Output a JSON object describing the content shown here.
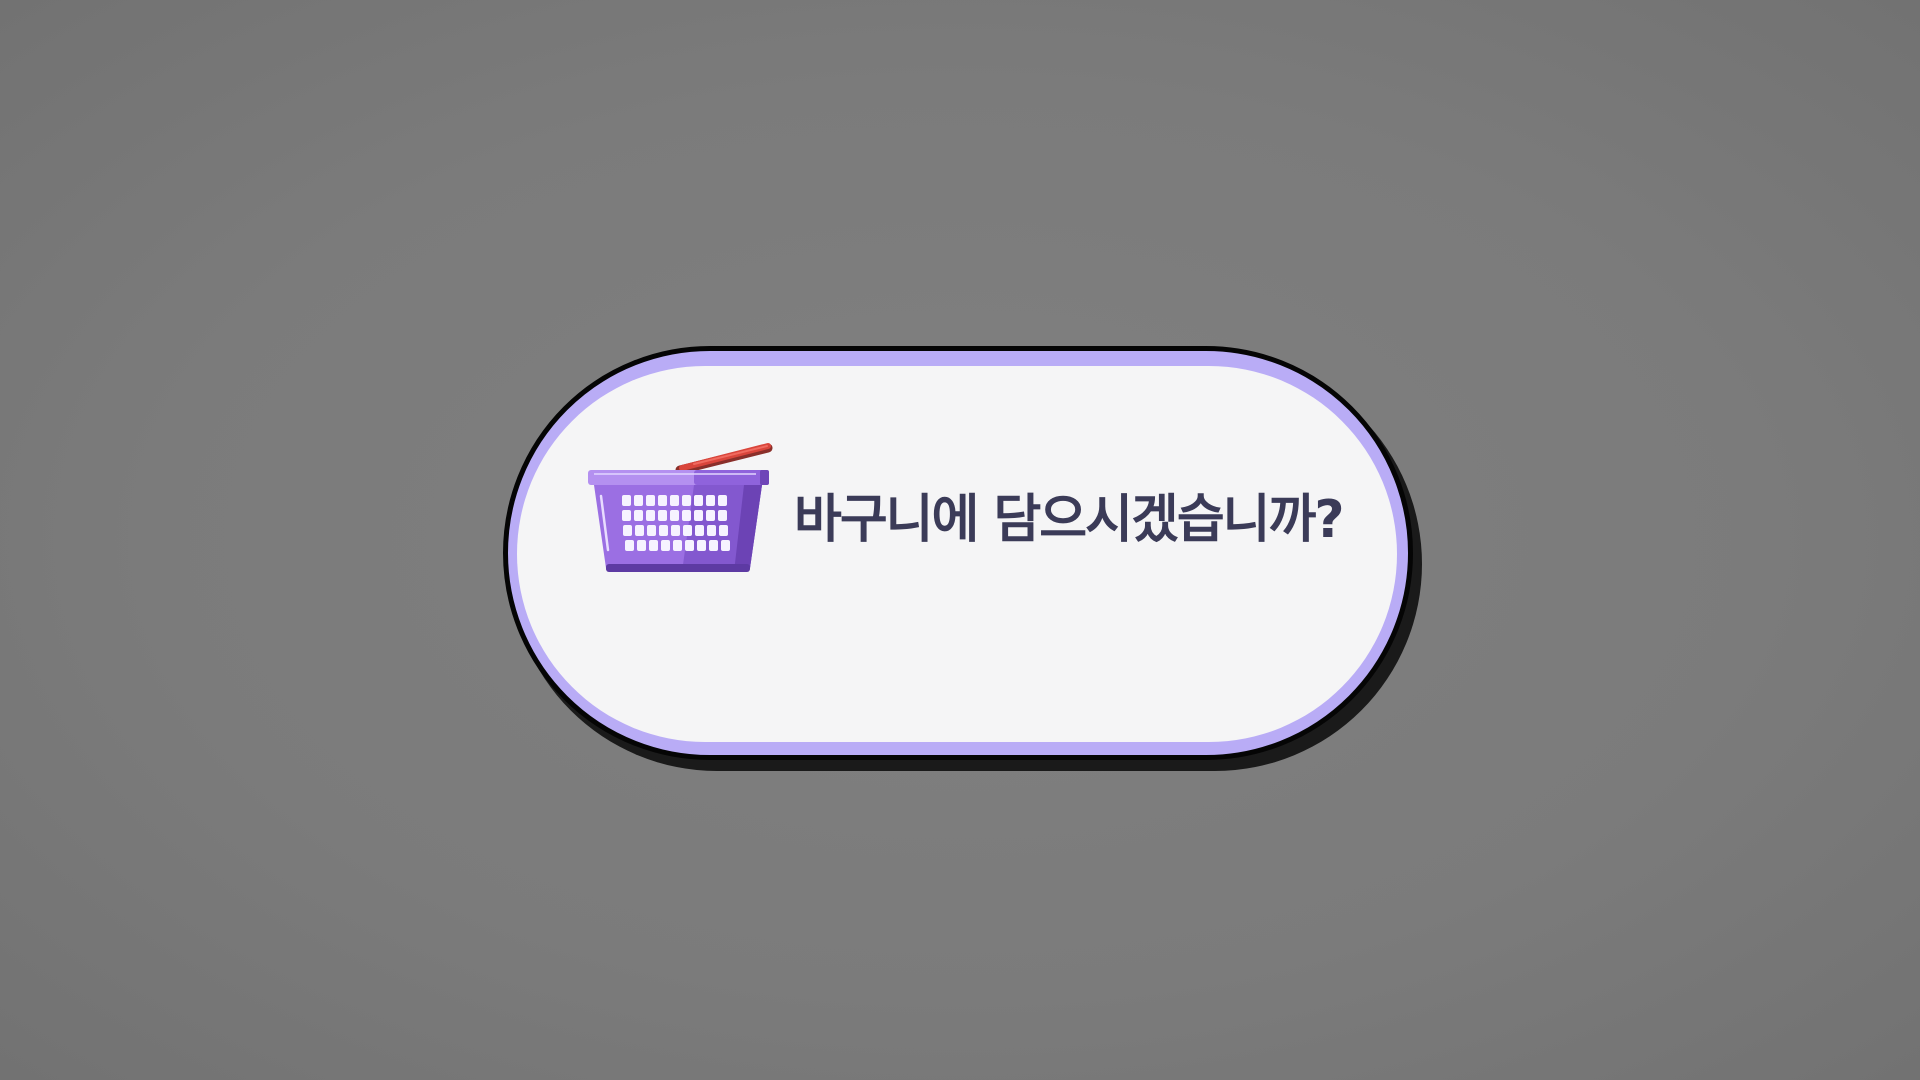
{
  "dialog": {
    "message": "바구니에 담으시겠습니까?",
    "icon": "shopping-basket-icon"
  },
  "colors": {
    "background": "#7c7c7c",
    "dialog_border": "#050505",
    "dialog_accent": "#b9acf6",
    "dialog_fill": "#f5f5f6",
    "text": "#3b3b58",
    "basket": "#9b6fe3",
    "basket_handle": "#d9453b"
  }
}
